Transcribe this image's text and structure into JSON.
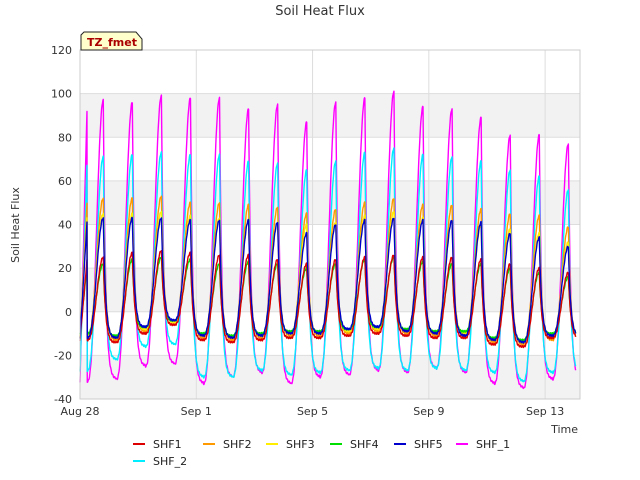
{
  "chart_data": {
    "type": "line",
    "title": "Soil Heat Flux",
    "xlabel": "Time",
    "ylabel": "Soil Heat Flux",
    "annotation": "TZ_fmet",
    "xlim": [
      0,
      17.2
    ],
    "ylim": [
      -40,
      120
    ],
    "y_ticks": [
      -40,
      -20,
      0,
      20,
      40,
      60,
      80,
      100,
      120
    ],
    "x_ticks": [
      {
        "value": 0,
        "label": "Aug 28"
      },
      {
        "value": 4,
        "label": "Sep 1"
      },
      {
        "value": 8,
        "label": "Sep 5"
      },
      {
        "value": 12,
        "label": "Sep 9"
      },
      {
        "value": 16,
        "label": "Sep 13"
      }
    ],
    "grid": true,
    "legend_position": "bottom",
    "peak_day_offset": [
      0.8,
      1.8,
      2.8,
      3.8,
      4.8,
      5.8,
      6.8,
      7.8,
      8.8,
      9.8,
      10.8,
      11.8,
      12.8,
      13.8,
      14.8,
      15.8,
      16.8
    ],
    "series": [
      {
        "name": "SHF1",
        "color": "#dd0000",
        "minima": [
          -13,
          -14,
          -10,
          -6,
          -13,
          -14,
          -13,
          -12,
          -12,
          -11,
          -10,
          -11,
          -12,
          -12,
          -15,
          -16,
          -12
        ],
        "peaks": [
          25,
          27,
          28,
          27,
          26,
          26,
          24,
          22,
          24,
          25,
          26,
          25,
          25,
          24,
          22,
          20,
          18
        ]
      },
      {
        "name": "SHF2",
        "color": "#ff9900",
        "minima": [
          -12,
          -13,
          -9,
          -5,
          -12,
          -13,
          -12,
          -11,
          -11,
          -10,
          -9,
          -10,
          -11,
          -11,
          -14,
          -15,
          -13
        ],
        "peaks": [
          52,
          52,
          53,
          50,
          50,
          49,
          48,
          45,
          47,
          50,
          52,
          49,
          49,
          47,
          45,
          44,
          39
        ]
      },
      {
        "name": "SHF3",
        "color": "#ffee00",
        "minima": [
          -11,
          -12,
          -8,
          -5,
          -11,
          -12,
          -11,
          -10,
          -10,
          -9,
          -8,
          -9,
          -10,
          -10,
          -13,
          -14,
          -11
        ],
        "peaks": [
          45,
          45,
          46,
          44,
          43,
          42,
          41,
          40,
          41,
          44,
          46,
          43,
          42,
          40,
          38,
          36,
          32
        ]
      },
      {
        "name": "SHF4",
        "color": "#00dd00",
        "minima": [
          -10,
          -11,
          -7,
          -4,
          -10,
          -11,
          -10,
          -9,
          -9,
          -8,
          -7,
          -8,
          -9,
          -9,
          -12,
          -13,
          -10
        ],
        "peaks": [
          22,
          24,
          25,
          24,
          22,
          23,
          22,
          20,
          22,
          24,
          25,
          23,
          22,
          22,
          20,
          18,
          16
        ]
      },
      {
        "name": "SHF5",
        "color": "#0000cc",
        "minima": [
          -12,
          -12,
          -7,
          -4,
          -11,
          -12,
          -11,
          -10,
          -10,
          -8,
          -7,
          -9,
          -10,
          -11,
          -13,
          -14,
          -11
        ],
        "peaks": [
          43,
          43,
          43,
          42,
          42,
          42,
          41,
          36,
          40,
          42,
          43,
          42,
          42,
          41,
          36,
          34,
          30
        ]
      },
      {
        "name": "SHF_1",
        "color": "#ff00ff",
        "minima": [
          -32,
          -31,
          -25,
          -24,
          -33,
          -30,
          -28,
          -33,
          -30,
          -29,
          -27,
          -28,
          -26,
          -28,
          -33,
          -35,
          -31
        ],
        "peaks": [
          97,
          96,
          99,
          98,
          98,
          93,
          95,
          87,
          96,
          98,
          101,
          94,
          93,
          89,
          81,
          81,
          77
        ]
      },
      {
        "name": "SHF_2",
        "color": "#00eeff",
        "minima": [
          -27,
          -22,
          -16,
          -15,
          -30,
          -30,
          -27,
          -29,
          -28,
          -27,
          -26,
          -27,
          -26,
          -27,
          -28,
          -32,
          -28
        ],
        "peaks": [
          71,
          72,
          73,
          72,
          72,
          69,
          68,
          65,
          69,
          73,
          75,
          72,
          71,
          69,
          65,
          62,
          56
        ]
      }
    ]
  }
}
